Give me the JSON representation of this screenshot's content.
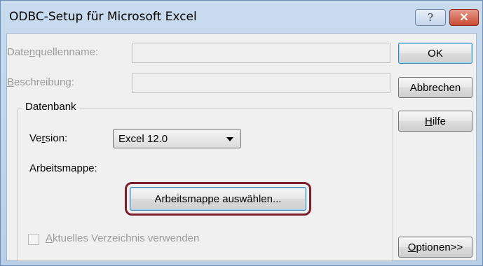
{
  "window": {
    "title": "ODBC-Setup für Microsoft Excel",
    "help_glyph": "?",
    "close_glyph": "✕"
  },
  "fields": {
    "datasource_label_pre": "Date",
    "datasource_label_u": "n",
    "datasource_label_post": "quellenname:",
    "datasource_value": "",
    "description_label_u": "B",
    "description_label_post": "eschreibung:",
    "description_value": ""
  },
  "buttons": {
    "ok": "OK",
    "cancel": "Abbrechen",
    "help_u": "H",
    "help_post": "ilfe",
    "options_u": "O",
    "options_post": "ptionen>>"
  },
  "database": {
    "group_label": "Datenbank",
    "version_label_pre": "Ve",
    "version_label_u": "r",
    "version_label_post": "sion:",
    "version_value": "Excel 12.0",
    "workbook_label": "Arbeitsmappe:",
    "select_workbook_label": "Arbeitsmappe auswählen...",
    "current_dir_label_u": "A",
    "current_dir_label_post": "ktuelles Verzeichnis verwenden",
    "current_dir_checked": false
  }
}
